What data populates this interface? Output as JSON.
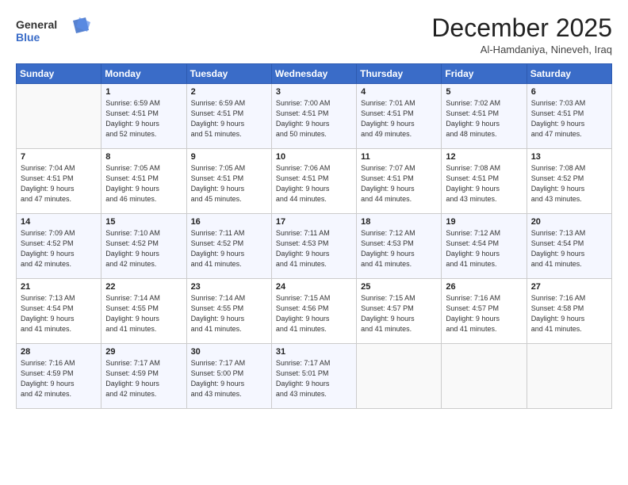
{
  "header": {
    "logo_line1": "General",
    "logo_line2": "Blue",
    "month": "December 2025",
    "location": "Al-Hamdaniya, Nineveh, Iraq"
  },
  "days_of_week": [
    "Sunday",
    "Monday",
    "Tuesday",
    "Wednesday",
    "Thursday",
    "Friday",
    "Saturday"
  ],
  "weeks": [
    [
      {
        "day": "",
        "content": ""
      },
      {
        "day": "1",
        "content": "Sunrise: 6:59 AM\nSunset: 4:51 PM\nDaylight: 9 hours\nand 52 minutes."
      },
      {
        "day": "2",
        "content": "Sunrise: 6:59 AM\nSunset: 4:51 PM\nDaylight: 9 hours\nand 51 minutes."
      },
      {
        "day": "3",
        "content": "Sunrise: 7:00 AM\nSunset: 4:51 PM\nDaylight: 9 hours\nand 50 minutes."
      },
      {
        "day": "4",
        "content": "Sunrise: 7:01 AM\nSunset: 4:51 PM\nDaylight: 9 hours\nand 49 minutes."
      },
      {
        "day": "5",
        "content": "Sunrise: 7:02 AM\nSunset: 4:51 PM\nDaylight: 9 hours\nand 48 minutes."
      },
      {
        "day": "6",
        "content": "Sunrise: 7:03 AM\nSunset: 4:51 PM\nDaylight: 9 hours\nand 47 minutes."
      }
    ],
    [
      {
        "day": "7",
        "content": "Sunrise: 7:04 AM\nSunset: 4:51 PM\nDaylight: 9 hours\nand 47 minutes."
      },
      {
        "day": "8",
        "content": "Sunrise: 7:05 AM\nSunset: 4:51 PM\nDaylight: 9 hours\nand 46 minutes."
      },
      {
        "day": "9",
        "content": "Sunrise: 7:05 AM\nSunset: 4:51 PM\nDaylight: 9 hours\nand 45 minutes."
      },
      {
        "day": "10",
        "content": "Sunrise: 7:06 AM\nSunset: 4:51 PM\nDaylight: 9 hours\nand 44 minutes."
      },
      {
        "day": "11",
        "content": "Sunrise: 7:07 AM\nSunset: 4:51 PM\nDaylight: 9 hours\nand 44 minutes."
      },
      {
        "day": "12",
        "content": "Sunrise: 7:08 AM\nSunset: 4:51 PM\nDaylight: 9 hours\nand 43 minutes."
      },
      {
        "day": "13",
        "content": "Sunrise: 7:08 AM\nSunset: 4:52 PM\nDaylight: 9 hours\nand 43 minutes."
      }
    ],
    [
      {
        "day": "14",
        "content": "Sunrise: 7:09 AM\nSunset: 4:52 PM\nDaylight: 9 hours\nand 42 minutes."
      },
      {
        "day": "15",
        "content": "Sunrise: 7:10 AM\nSunset: 4:52 PM\nDaylight: 9 hours\nand 42 minutes."
      },
      {
        "day": "16",
        "content": "Sunrise: 7:11 AM\nSunset: 4:52 PM\nDaylight: 9 hours\nand 41 minutes."
      },
      {
        "day": "17",
        "content": "Sunrise: 7:11 AM\nSunset: 4:53 PM\nDaylight: 9 hours\nand 41 minutes."
      },
      {
        "day": "18",
        "content": "Sunrise: 7:12 AM\nSunset: 4:53 PM\nDaylight: 9 hours\nand 41 minutes."
      },
      {
        "day": "19",
        "content": "Sunrise: 7:12 AM\nSunset: 4:54 PM\nDaylight: 9 hours\nand 41 minutes."
      },
      {
        "day": "20",
        "content": "Sunrise: 7:13 AM\nSunset: 4:54 PM\nDaylight: 9 hours\nand 41 minutes."
      }
    ],
    [
      {
        "day": "21",
        "content": "Sunrise: 7:13 AM\nSunset: 4:54 PM\nDaylight: 9 hours\nand 41 minutes."
      },
      {
        "day": "22",
        "content": "Sunrise: 7:14 AM\nSunset: 4:55 PM\nDaylight: 9 hours\nand 41 minutes."
      },
      {
        "day": "23",
        "content": "Sunrise: 7:14 AM\nSunset: 4:55 PM\nDaylight: 9 hours\nand 41 minutes."
      },
      {
        "day": "24",
        "content": "Sunrise: 7:15 AM\nSunset: 4:56 PM\nDaylight: 9 hours\nand 41 minutes."
      },
      {
        "day": "25",
        "content": "Sunrise: 7:15 AM\nSunset: 4:57 PM\nDaylight: 9 hours\nand 41 minutes."
      },
      {
        "day": "26",
        "content": "Sunrise: 7:16 AM\nSunset: 4:57 PM\nDaylight: 9 hours\nand 41 minutes."
      },
      {
        "day": "27",
        "content": "Sunrise: 7:16 AM\nSunset: 4:58 PM\nDaylight: 9 hours\nand 41 minutes."
      }
    ],
    [
      {
        "day": "28",
        "content": "Sunrise: 7:16 AM\nSunset: 4:59 PM\nDaylight: 9 hours\nand 42 minutes."
      },
      {
        "day": "29",
        "content": "Sunrise: 7:17 AM\nSunset: 4:59 PM\nDaylight: 9 hours\nand 42 minutes."
      },
      {
        "day": "30",
        "content": "Sunrise: 7:17 AM\nSunset: 5:00 PM\nDaylight: 9 hours\nand 43 minutes."
      },
      {
        "day": "31",
        "content": "Sunrise: 7:17 AM\nSunset: 5:01 PM\nDaylight: 9 hours\nand 43 minutes."
      },
      {
        "day": "",
        "content": ""
      },
      {
        "day": "",
        "content": ""
      },
      {
        "day": "",
        "content": ""
      }
    ]
  ]
}
